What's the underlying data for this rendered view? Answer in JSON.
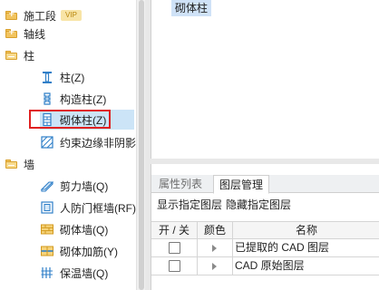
{
  "tree": {
    "categories": [
      {
        "label": "施工段",
        "vip": "VIP"
      },
      {
        "label": "轴线"
      },
      {
        "label": "柱"
      },
      {
        "label": "墙"
      }
    ],
    "column_items": [
      {
        "label": "柱(Z)",
        "icon": "column-icon"
      },
      {
        "label": "构造柱(Z)",
        "icon": "structural-column-icon"
      },
      {
        "label": "砌体柱(Z)",
        "icon": "masonry-column-icon"
      },
      {
        "label": "约束边缘非阴影区",
        "icon": "edge-zone-icon"
      }
    ],
    "wall_items": [
      {
        "label": "剪力墙(Q)",
        "icon": "shear-wall-icon"
      },
      {
        "label": "人防门框墙(RF)",
        "icon": "civil-defense-door-frame-wall-icon"
      },
      {
        "label": "砌体墙(Q)",
        "icon": "masonry-wall-icon"
      },
      {
        "label": "砌体加筋(Y)",
        "icon": "masonry-reinforcement-icon"
      },
      {
        "label": "保温墙(Q)",
        "icon": "insulation-wall-icon"
      }
    ]
  },
  "top_panel": {
    "selected_text": "砌体柱"
  },
  "layer_panel": {
    "tabs": [
      {
        "label": "属性列表",
        "active": false
      },
      {
        "label": "图层管理",
        "active": true
      }
    ],
    "actions": {
      "show": "显示指定图层",
      "hide": "隐藏指定图层"
    },
    "columns": {
      "toggle": "开 / 关",
      "color": "颜色",
      "name": "名称"
    },
    "rows": [
      {
        "checked": false,
        "name": "已提取的 CAD 图层"
      },
      {
        "checked": false,
        "name": "CAD 原始图层"
      }
    ]
  },
  "colors": {
    "selection": "#cce4f7",
    "highlight_box": "#e02020",
    "folder": "#f2c45f"
  }
}
